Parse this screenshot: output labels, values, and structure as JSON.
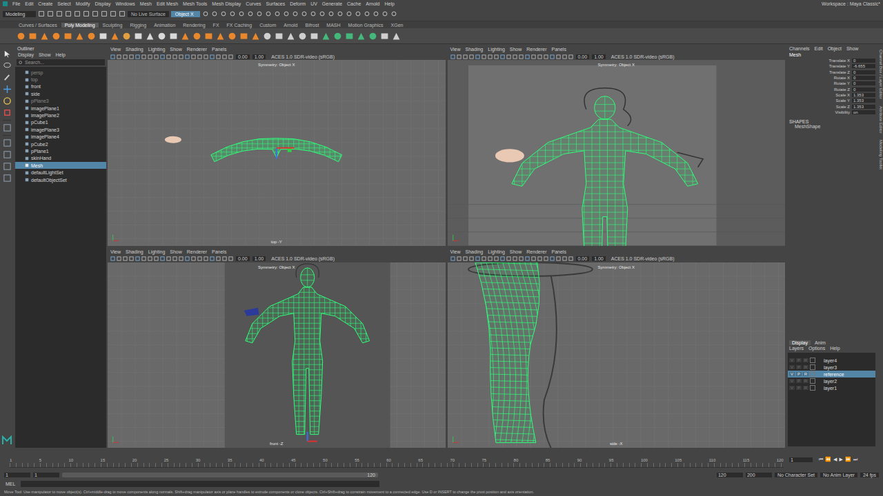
{
  "menubar": {
    "items": [
      "File",
      "Edit",
      "Create",
      "Select",
      "Modify",
      "Display",
      "Windows",
      "Mesh",
      "Edit Mesh",
      "Mesh Tools",
      "Mesh Display",
      "Curves",
      "Surfaces",
      "Deform",
      "UV",
      "Generate",
      "Cache",
      "Arnold",
      "Help"
    ],
    "workspace": "Workspace : Maya Classic*"
  },
  "status_line": {
    "mode": "Modeling",
    "live_surface": "No Live Surface",
    "symmetry": "Object X"
  },
  "shelf": {
    "tabs": [
      {
        "label": "Curves / Surfaces",
        "selected": false
      },
      {
        "label": "Poly Modeling",
        "selected": true
      },
      {
        "label": "Sculpting",
        "selected": false
      },
      {
        "label": "Rigging",
        "selected": false
      },
      {
        "label": "Animation",
        "selected": false
      },
      {
        "label": "Rendering",
        "selected": false
      },
      {
        "label": "FX",
        "selected": false
      },
      {
        "label": "FX Caching",
        "selected": false
      },
      {
        "label": "Custom",
        "selected": false
      },
      {
        "label": "Arnold",
        "selected": false
      },
      {
        "label": "Bifrost",
        "selected": false
      },
      {
        "label": "MASH",
        "selected": false
      },
      {
        "label": "Motion Graphics",
        "selected": false
      },
      {
        "label": "XGen",
        "selected": false
      }
    ]
  },
  "outliner": {
    "title": "Outliner",
    "menu": [
      "Display",
      "Show",
      "Help"
    ],
    "search_placeholder": "Search...",
    "items": [
      {
        "label": "persp",
        "selected": false,
        "dimmed": true
      },
      {
        "label": "top",
        "selected": false,
        "dimmed": true
      },
      {
        "label": "front",
        "selected": false,
        "dimmed": false
      },
      {
        "label": "side",
        "selected": false,
        "dimmed": false
      },
      {
        "label": "pPlane3",
        "selected": false,
        "dimmed": true
      },
      {
        "label": "imagePlane1",
        "selected": false,
        "dimmed": false
      },
      {
        "label": "imagePlane2",
        "selected": false,
        "dimmed": false
      },
      {
        "label": "pCube1",
        "selected": false,
        "dimmed": false
      },
      {
        "label": "imagePlane3",
        "selected": false,
        "dimmed": false
      },
      {
        "label": "imagePlane4",
        "selected": false,
        "dimmed": false
      },
      {
        "label": "pCube2",
        "selected": false,
        "dimmed": false
      },
      {
        "label": "pPlane1",
        "selected": false,
        "dimmed": false
      },
      {
        "label": "skinHand",
        "selected": false,
        "dimmed": false
      },
      {
        "label": "Mesh",
        "selected": true,
        "dimmed": false
      },
      {
        "label": "defaultLightSet",
        "selected": false,
        "dimmed": false
      },
      {
        "label": "defaultObjectSet",
        "selected": false,
        "dimmed": false
      }
    ]
  },
  "viewports": [
    {
      "kind": "top",
      "menu": [
        "View",
        "Shading",
        "Lighting",
        "Show",
        "Renderer",
        "Panels"
      ],
      "exposure": "0.00",
      "gamma": "1.00",
      "color_space": "ACES 1.0 SDR-video (sRGB)",
      "symmetry": "Symmetry: Object X",
      "label": "top -Y"
    },
    {
      "kind": "persp",
      "menu": [
        "View",
        "Shading",
        "Lighting",
        "Show",
        "Renderer",
        "Panels"
      ],
      "exposure": "0.00",
      "gamma": "1.00",
      "color_space": "ACES 1.0 SDR-video (sRGB)",
      "symmetry": "Symmetry: Object X",
      "label": ""
    },
    {
      "kind": "front",
      "menu": [
        "View",
        "Shading",
        "Lighting",
        "Show",
        "Renderer",
        "Panels"
      ],
      "exposure": "0.00",
      "gamma": "1.00",
      "color_space": "ACES 1.0 SDR-video (sRGB)",
      "symmetry": "Symmetry: Object X",
      "label": "front -Z"
    },
    {
      "kind": "side",
      "menu": [
        "View",
        "Shading",
        "Lighting",
        "Show",
        "Renderer",
        "Panels"
      ],
      "exposure": "0.00",
      "gamma": "1.00",
      "color_space": "ACES 1.0 SDR-video (sRGB)",
      "symmetry": "Symmetry: Object X",
      "label": "side -X"
    }
  ],
  "channel_box": {
    "menu": [
      "Channels",
      "Edit",
      "Object",
      "Show"
    ],
    "object": "Mesh",
    "attributes": [
      {
        "name": "Translate X",
        "value": "0"
      },
      {
        "name": "Translate Y",
        "value": "-6.655"
      },
      {
        "name": "Translate Z",
        "value": "0"
      },
      {
        "name": "Rotate X",
        "value": "0"
      },
      {
        "name": "Rotate Y",
        "value": "0"
      },
      {
        "name": "Rotate Z",
        "value": "0"
      },
      {
        "name": "Scale X",
        "value": "1.353"
      },
      {
        "name": "Scale Y",
        "value": "1.353"
      },
      {
        "name": "Scale Z",
        "value": "1.353"
      },
      {
        "name": "Visibility",
        "value": "on"
      }
    ],
    "shapes_header": "SHAPES",
    "shape": "MeshShape"
  },
  "side_tabs": [
    "Channel Box / Layer Editor",
    "Attribute Editor",
    "Modeling Toolkit"
  ],
  "layer_editor": {
    "tabs": [
      {
        "label": "Display",
        "selected": true
      },
      {
        "label": "Anim",
        "selected": false
      }
    ],
    "menu": [
      "Layers",
      "Options",
      "Help"
    ],
    "flags": [
      "V",
      "P",
      "R"
    ],
    "layers": [
      {
        "name": "layer4",
        "selected": false
      },
      {
        "name": "layer3",
        "selected": false
      },
      {
        "name": "reference",
        "selected": true
      },
      {
        "name": "layer2",
        "selected": false
      },
      {
        "name": "layer1",
        "selected": false
      }
    ]
  },
  "time_slider": {
    "ticks": [
      "1",
      "5",
      "10",
      "15",
      "20",
      "25",
      "30",
      "35",
      "40",
      "45",
      "50",
      "55",
      "60",
      "65",
      "70",
      "75",
      "80",
      "85",
      "90",
      "95",
      "100",
      "105",
      "110",
      "115",
      "120"
    ],
    "current": "1",
    "controls": [
      "⏮",
      "⏪",
      "◀",
      "▶",
      "⏩",
      "⏭"
    ]
  },
  "range_slider": {
    "start": "1",
    "inner_start": "1",
    "inner_end": "120",
    "end": "120",
    "max": "200",
    "character_set": "No Character Set",
    "anim_layer": "No Anim Layer",
    "fps": "24 fps"
  },
  "command_line": {
    "language": "MEL"
  },
  "help_line": "Move Tool: Use manipulator to move object(s). Ctrl+middle-drag to move components along normals. Shift+drag manipulator axis or plane handles to extrude components or clone objects. Ctrl+Shift+drag to constrain movement to a connected edge. Use D or INSERT to change the pivot position and axis orientation."
}
